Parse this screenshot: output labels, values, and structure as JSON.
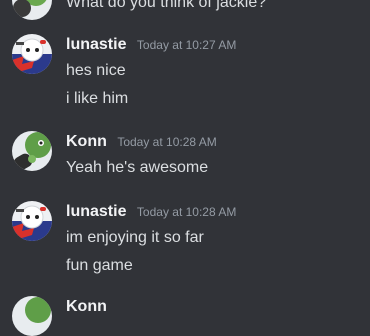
{
  "chat": {
    "top_partial": {
      "text": "What do you think of jackie?"
    },
    "groups": [
      {
        "username": "lunastie",
        "timestamp": "Today at 10:27 AM",
        "avatar_icon": "white-character-avatar",
        "messages": [
          "hes nice",
          "i like him"
        ]
      },
      {
        "username": "Konn",
        "timestamp": "Today at 10:28 AM",
        "avatar_icon": "green-character-avatar",
        "messages": [
          "Yeah he's awesome"
        ]
      },
      {
        "username": "lunastie",
        "timestamp": "Today at 10:28 AM",
        "avatar_icon": "white-character-avatar",
        "messages": [
          "im enjoying it so far",
          "fun game"
        ]
      },
      {
        "username": "Konn",
        "timestamp": "",
        "avatar_icon": "green-character-avatar",
        "messages": []
      }
    ]
  },
  "colors": {
    "background": "#313338",
    "username": "#f2f3f5",
    "timestamp": "#949ba4",
    "message": "#dbdee1"
  }
}
